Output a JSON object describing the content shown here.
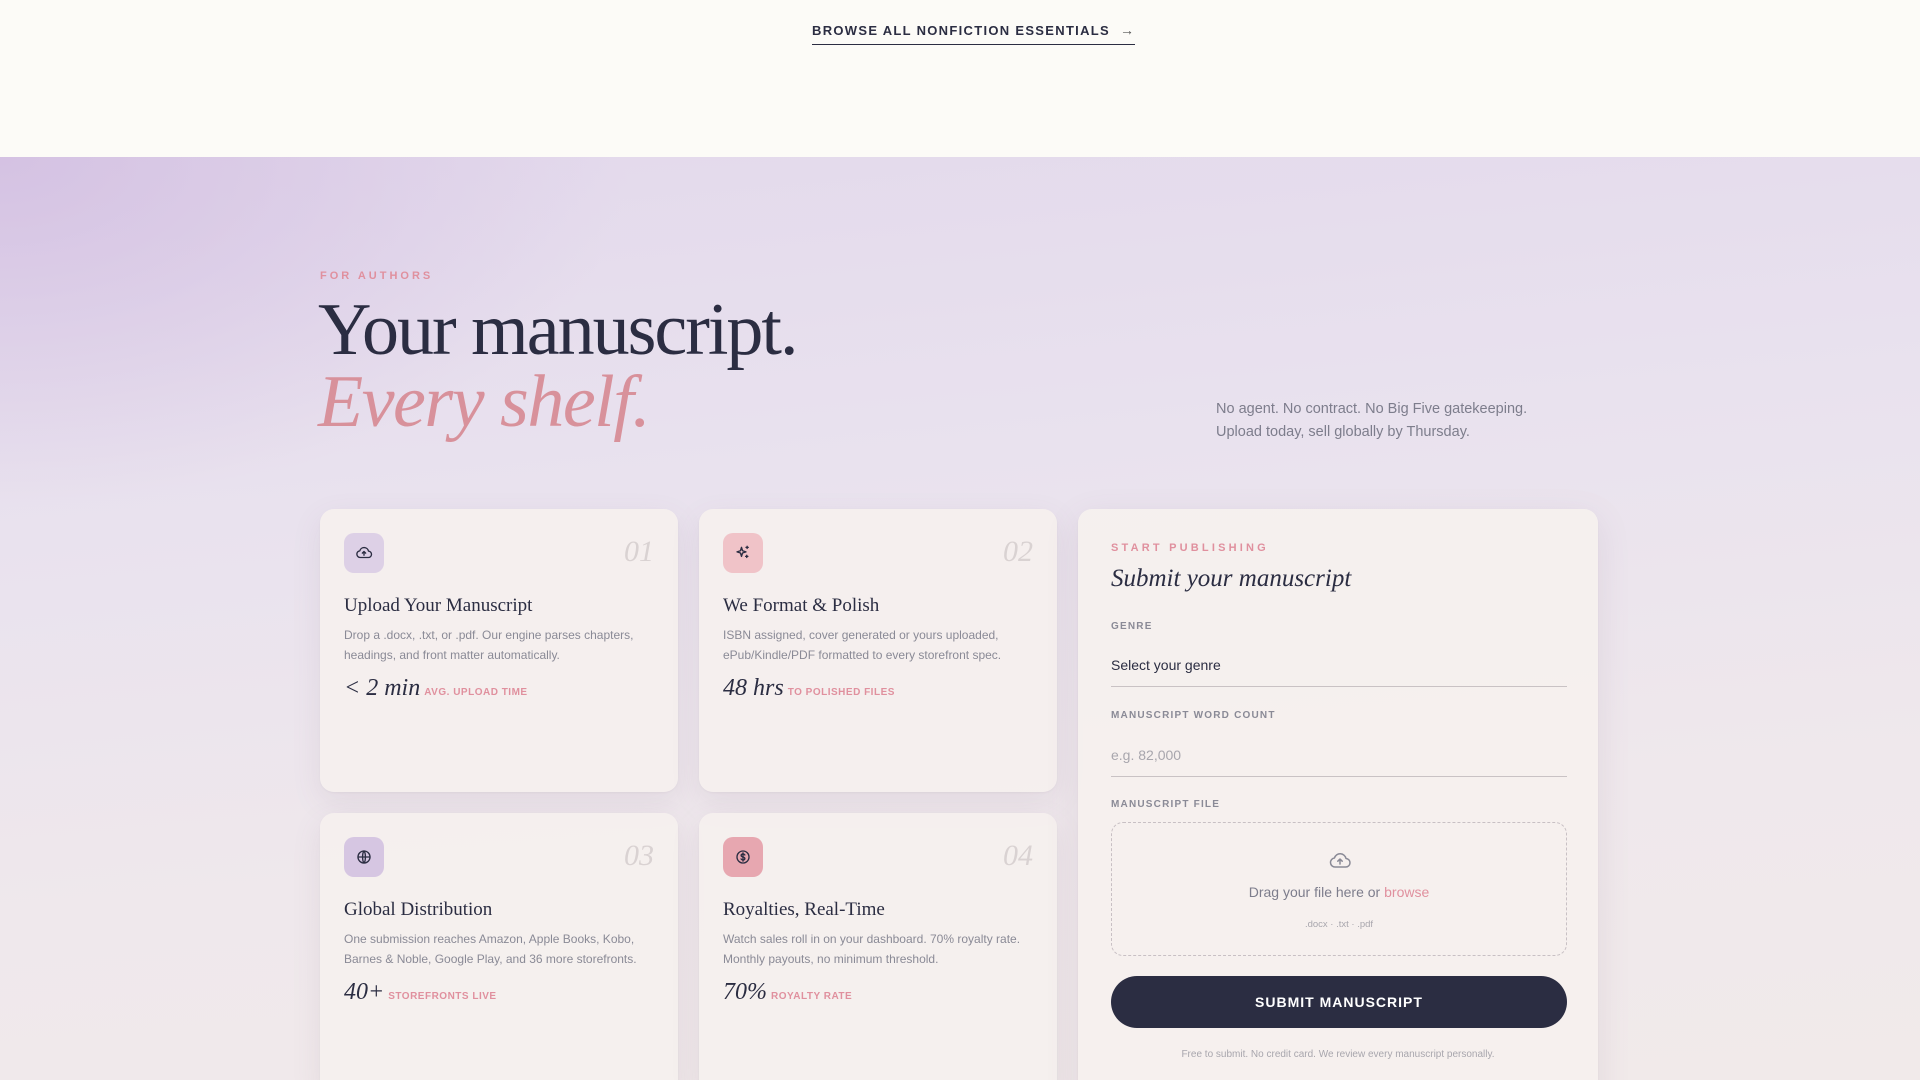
{
  "topbar": {
    "browse_label": "BROWSE ALL NONFICTION ESSENTIALS",
    "browse_arrow": "→"
  },
  "hero": {
    "eyebrow": "FOR AUTHORS",
    "title_line1": "Your manuscript.",
    "title_line2": "Every shelf.",
    "description": "No agent. No contract. No Big Five gatekeeping. Upload today, sell globally by Thursday."
  },
  "cards": [
    {
      "number": "01",
      "icon": "cloud-upload-icon",
      "title": "Upload Your Manuscript",
      "description": "Drop a .docx, .txt, or .pdf. Our engine parses chapters, headings, and front matter automatically.",
      "stat_value": "< 2 min",
      "stat_label": "AVG. UPLOAD TIME"
    },
    {
      "number": "02",
      "icon": "sparkles-icon",
      "title": "We Format & Polish",
      "description": "ISBN assigned, cover generated or yours uploaded, ePub/Kindle/PDF formatted to every storefront spec.",
      "stat_value": "48 hrs",
      "stat_label": "TO POLISHED FILES"
    },
    {
      "number": "03",
      "icon": "globe-icon",
      "title": "Global Distribution",
      "description": "One submission reaches Amazon, Apple Books, Kobo, Barnes & Noble, Google Play, and 36 more storefronts.",
      "stat_value": "40+",
      "stat_label": "STOREFRONTS LIVE"
    },
    {
      "number": "04",
      "icon": "dollar-coin-icon",
      "title": "Royalties, Real-Time",
      "description": "Watch sales roll in on your dashboard. 70% royalty rate. Monthly payouts, no minimum threshold.",
      "stat_value": "70%",
      "stat_label": "ROYALTY RATE"
    }
  ],
  "form": {
    "eyebrow": "START PUBLISHING",
    "title": "Submit your manuscript",
    "genre_label": "GENRE",
    "genre_value": "Select your genre",
    "wordcount_label": "MANUSCRIPT WORD COUNT",
    "wordcount_placeholder": "e.g. 82,000",
    "file_label": "MANUSCRIPT FILE",
    "dropzone_text": "Drag your file here or",
    "dropzone_browse": "browse",
    "dropzone_types": ".docx · .txt · .pdf",
    "submit_label": "SUBMIT MANUSCRIPT",
    "footnote": "Free to submit. No credit card. We review every manuscript personally."
  },
  "colors": {
    "accent": "#e0909e",
    "ink": "#2b2d42",
    "tile_lilac": "#ddd0e6",
    "tile_pink": "#f0c3c8",
    "tile_violet": "#d6c6e2",
    "tile_rose": "#e7a7b0"
  }
}
